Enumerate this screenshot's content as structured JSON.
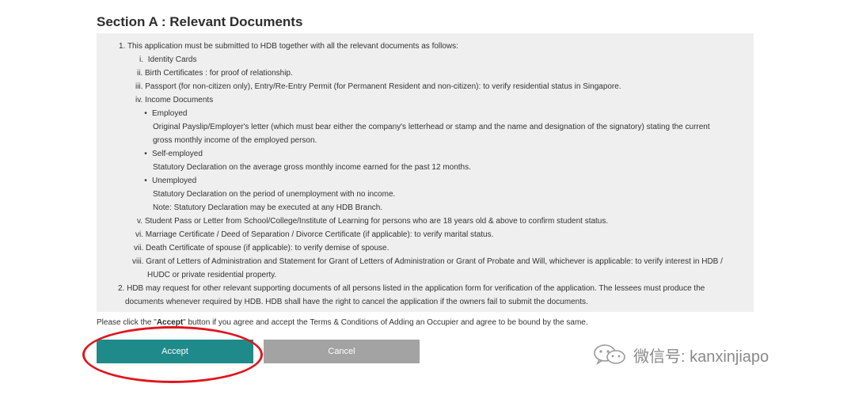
{
  "section": {
    "title": "Section A : Relevant Documents"
  },
  "documents": {
    "item1_intro": "1. This application must be submitted to HDB together with all the relevant documents as follows:",
    "i": {
      "num": "i.",
      "text": "Identity Cards"
    },
    "ii": {
      "num": "ii.",
      "text": "Birth Certificates : for proof of relationship."
    },
    "iii": {
      "num": "iii.",
      "text": "Passport (for non-citizen only), Entry/Re-Entry Permit (for Permanent Resident and non-citizen): to verify residential status in Singapore."
    },
    "iv": {
      "num": "iv.",
      "text": "Income Documents"
    },
    "employed": {
      "label": "Employed",
      "desc_line1": "Original Payslip/Employer's letter (which must bear either the company's letterhead or stamp and the name and designation of the signatory) stating the current",
      "desc_line2": "gross monthly income of the employed person."
    },
    "self_employed": {
      "label": "Self-employed",
      "desc": "Statutory Declaration on the average gross monthly income earned for the past 12 months."
    },
    "unemployed": {
      "label": "Unemployed",
      "desc": "Statutory Declaration on the period of unemployment with no income.",
      "note": "Note: Statutory Declaration may be executed at any HDB Branch."
    },
    "v": {
      "num": "v.",
      "text": "Student Pass or Letter from School/College/Institute of Learning for persons who are 18 years old & above to confirm student status."
    },
    "vi": {
      "num": "vi.",
      "text": "Marriage Certificate / Deed of Separation / Divorce Certificate (if applicable): to verify marital status."
    },
    "vii": {
      "num": "vii.",
      "text": "Death Certificate of spouse (if applicable): to verify demise of spouse."
    },
    "viii": {
      "num": "viii.",
      "text_line1": "Grant of Letters of Administration and Statement for Grant of Letters of Administration or Grant of Probate and Will, whichever is applicable: to verify  interest in HDB /",
      "text_line2": "HUDC or private residential property."
    },
    "item2_line1": "2. HDB may request for other relevant supporting documents of all persons listed in the application form for verification of the application. The lessees must produce the",
    "item2_line2": "documents whenever required by HDB. HDB shall have the right to cancel the application if the owners fail to submit the documents."
  },
  "notice": {
    "prefix": "Please click the \"",
    "bold": "Accept",
    "suffix": "\" button if you agree and accept the Terms & Conditions of Adding an Occupier and agree to be bound by the same."
  },
  "buttons": {
    "accept": "Accept",
    "cancel": "Cancel"
  },
  "colors": {
    "accept_bg": "#1f8a8a",
    "cancel_bg": "#a3a3a3",
    "highlight_ring": "#e0161d",
    "panel_bg": "#efefef"
  },
  "watermark": {
    "icon": "wechat-icon",
    "text": "微信号: kanxinjiapo"
  }
}
